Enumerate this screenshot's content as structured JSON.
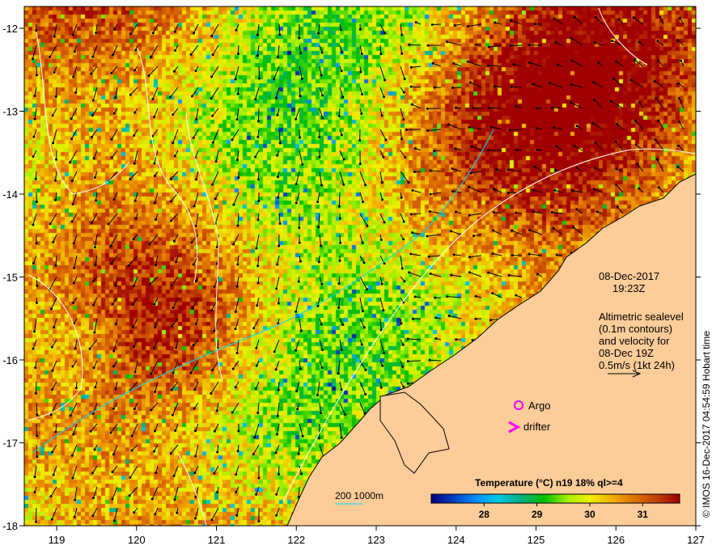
{
  "map": {
    "lon_ticks": [
      "119",
      "120",
      "121",
      "122",
      "123",
      "124",
      "125",
      "126",
      "127"
    ],
    "lat_ticks": [
      "-12",
      "-13",
      "-14",
      "-15",
      "-16",
      "-17",
      "-18"
    ],
    "date": "08-Dec-2017",
    "time": "19:23Z",
    "notes": [
      "Altimetric sealevel",
      "(0.1m contours)",
      "and velocity for",
      "08-Dec 19Z",
      "0.5m/s (1kt 24h)"
    ],
    "argo_label": "Argo",
    "drifter_label": "drifter",
    "depth_label": "200  1000m",
    "credit": "© IMOS 16-Dec-2017 04:54:59 Hobart time",
    "colors": {
      "land": "#fccc99",
      "argo": "#ff00ff",
      "contour": "#ffffff",
      "depth": "#00ffff"
    }
  },
  "colorbar": {
    "title": "Temperature (°C) n19 18% ql>=4",
    "ticks": [
      "28",
      "29",
      "30",
      "31"
    ],
    "range": [
      27.0,
      31.7
    ],
    "stops": [
      "#000080",
      "#0040c0",
      "#0090ff",
      "#00c8e0",
      "#00b080",
      "#00c000",
      "#a0f000",
      "#f0f000",
      "#f0b000",
      "#e07000",
      "#c04000",
      "#a00000"
    ]
  }
}
